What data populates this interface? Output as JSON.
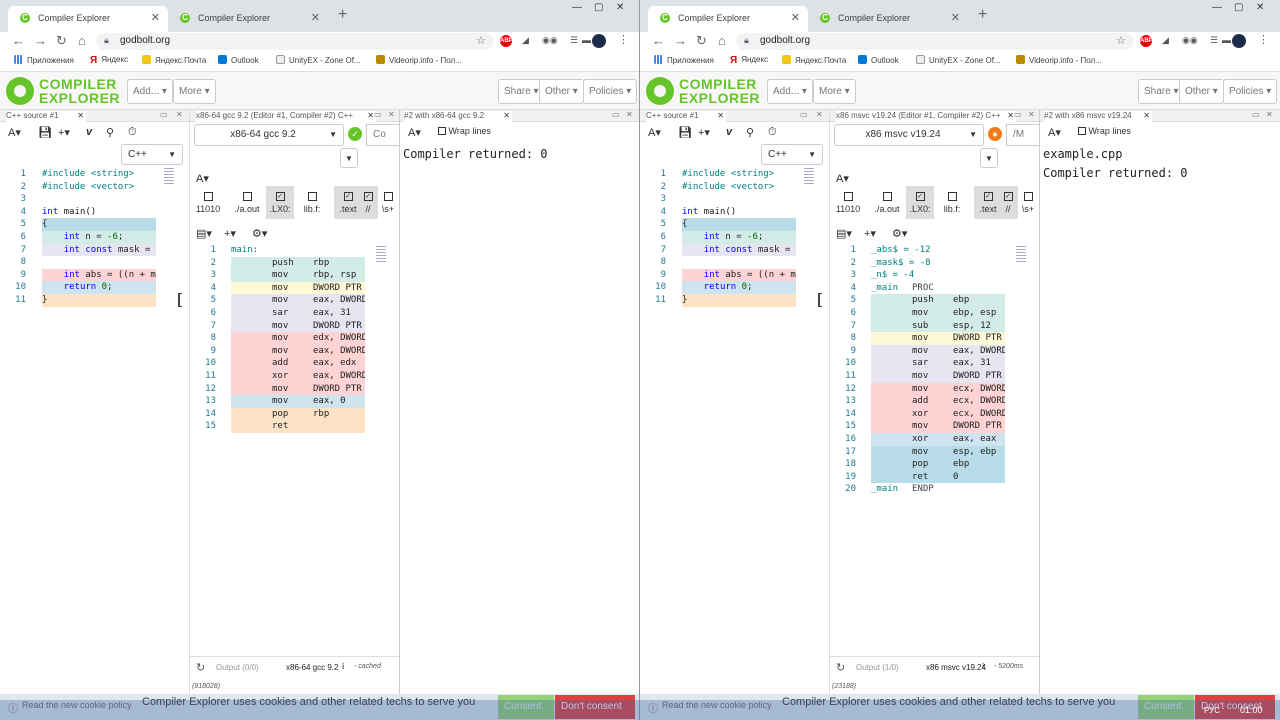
{
  "tabs_left": [
    {
      "label": "Compiler Explorer",
      "favicon": "C"
    },
    {
      "label": "Compiler Explorer",
      "favicon": "C"
    }
  ],
  "tabs_right": [
    {
      "label": "Compiler Explorer",
      "favicon": "C"
    },
    {
      "label": "Compiler Explorer",
      "favicon": "C"
    }
  ],
  "address": {
    "url": "godbolt.org"
  },
  "extensions": {
    "abp": "ABP"
  },
  "bookmarks": [
    "Приложения",
    "Яндекс",
    "Яндекс.Почта",
    "Outlook",
    "UnityEX - Zone Of...",
    "Videorip.info - Пол..."
  ],
  "colors": {
    "accent": "#67c52a",
    "asm_push": "#d4ece8",
    "asm_lavender": "#e6e6f2",
    "asm_yellow": "#fdf8d6",
    "asm_red": "#fdd3d3",
    "asm_blue": "#d0e4f0",
    "asm_orange": "#fde3c6",
    "asm_teal": "#b8dde8",
    "consent": "#67c52a",
    "dont_consent": "#e04040"
  },
  "header": {
    "logo_line1": "COMPILER",
    "logo_line2": "EXPLORER",
    "add": "Add...",
    "more": "More",
    "share": "Share",
    "other": "Other",
    "policies": "Policies"
  },
  "source_code": [
    {
      "n": "1",
      "t": "#include <string>",
      "bg": "none"
    },
    {
      "n": "2",
      "t": "#include <vector>",
      "bg": "none"
    },
    {
      "n": "3",
      "t": "",
      "bg": "none"
    },
    {
      "n": "4",
      "t": "int main()",
      "bg": "none"
    },
    {
      "n": "5",
      "t": "{",
      "bg": "teal"
    },
    {
      "n": "6",
      "t": "    int n = -6;",
      "bg": "push"
    },
    {
      "n": "7",
      "t": "    int const mask = m",
      "bg": "lavender"
    },
    {
      "n": "8",
      "t": "",
      "bg": "none"
    },
    {
      "n": "9",
      "t": "    int abs = ((n + ma",
      "bg": "red"
    },
    {
      "n": "10",
      "t": "    return 0;",
      "bg": "blue"
    },
    {
      "n": "11",
      "t": "}",
      "bg": "orange"
    }
  ],
  "left": {
    "source_tab": "C++ source #1",
    "language": "C++",
    "compiler_tab": "x86-64 gcc 9.2 (Editor #1, Compiler #2) C++",
    "compiler": "x86-64 gcc 9.2",
    "compiler_opts": "Co",
    "output_tab": "#2 with x86-64 gcc 9.2",
    "wrap_lines": "Wrap lines",
    "output_lines": [
      "Compiler returned: 0"
    ],
    "filters": [
      {
        "label": "11010",
        "checked": false
      },
      {
        "label": "./a.out",
        "checked": false
      },
      {
        "label": ".LX0:",
        "checked": true
      },
      {
        "label": "lib.f:",
        "checked": false
      },
      {
        "label": ".text",
        "checked": true
      },
      {
        "label": "//",
        "checked": true
      },
      {
        "label": "\\s+",
        "checked": false
      }
    ],
    "asm": [
      {
        "n": "1",
        "op": "main:",
        "arg": "",
        "bg": "none",
        "label": true
      },
      {
        "n": "2",
        "op": "push",
        "arg": "rbp",
        "bg": "push"
      },
      {
        "n": "3",
        "op": "mov",
        "arg": "rbp, rsp",
        "bg": "push"
      },
      {
        "n": "4",
        "op": "mov",
        "arg": "DWORD PTR",
        "bg": "yellow"
      },
      {
        "n": "5",
        "op": "mov",
        "arg": "eax, DWORD",
        "bg": "lavender"
      },
      {
        "n": "6",
        "op": "sar",
        "arg": "eax, 31",
        "bg": "lavender"
      },
      {
        "n": "7",
        "op": "mov",
        "arg": "DWORD PTR",
        "bg": "lavender"
      },
      {
        "n": "8",
        "op": "mov",
        "arg": "edx, DWORD",
        "bg": "red"
      },
      {
        "n": "9",
        "op": "mov",
        "arg": "eax, DWORD",
        "bg": "red"
      },
      {
        "n": "10",
        "op": "add",
        "arg": "eax, edx",
        "bg": "red"
      },
      {
        "n": "11",
        "op": "xor",
        "arg": "eax, DWORD",
        "bg": "red"
      },
      {
        "n": "12",
        "op": "mov",
        "arg": "DWORD PTR",
        "bg": "red"
      },
      {
        "n": "13",
        "op": "mov",
        "arg": "eax, 0",
        "bg": "blue"
      },
      {
        "n": "14",
        "op": "pop",
        "arg": "rbp",
        "bg": "orange"
      },
      {
        "n": "15",
        "op": "ret",
        "arg": "",
        "bg": "orange"
      }
    ],
    "status": {
      "output": "Output (0/0)",
      "compiler": "x86-64 gcc 9.2",
      "info": "i",
      "cached": "- cached",
      "bytes": "(918028)"
    }
  },
  "right": {
    "source_tab": "C++ source #1",
    "language": "C++",
    "compiler_tab": "x86 msvc v19.24 (Editor #1, Compiler #2) C++",
    "compiler": "x86 msvc v19.24",
    "compiler_opts": "/M",
    "output_tab": "#2 with x86 msvc v19.24",
    "wrap_lines": "Wrap lines",
    "output_lines": [
      "example.cpp",
      "Compiler returned: 0"
    ],
    "filters": [
      {
        "label": "11010",
        "checked": false
      },
      {
        "label": "./a.out",
        "checked": false
      },
      {
        "label": ".LX0:",
        "checked": true
      },
      {
        "label": "lib.f:",
        "checked": false
      },
      {
        "label": ".text",
        "checked": true
      },
      {
        "label": "//",
        "checked": true
      },
      {
        "label": "\\s+",
        "checked": false
      }
    ],
    "asm": [
      {
        "n": "1",
        "op": "_abs$ = -12",
        "arg": "",
        "bg": "none",
        "label": true
      },
      {
        "n": "2",
        "op": "_mask$ = -8",
        "arg": "",
        "bg": "none",
        "label": true
      },
      {
        "n": "3",
        "op": "_n$ = -4",
        "arg": "",
        "bg": "none",
        "label": true
      },
      {
        "n": "4",
        "op": "_main",
        "arg": "PROC",
        "bg": "none",
        "label": true
      },
      {
        "n": "5",
        "op": "push",
        "arg": "ebp",
        "bg": "push"
      },
      {
        "n": "6",
        "op": "mov",
        "arg": "ebp, esp",
        "bg": "push"
      },
      {
        "n": "7",
        "op": "sub",
        "arg": "esp, 12",
        "bg": "push"
      },
      {
        "n": "8",
        "op": "mov",
        "arg": "DWORD PTR",
        "bg": "yellow"
      },
      {
        "n": "9",
        "op": "mov",
        "arg": "eax, DWORD",
        "bg": "lavender"
      },
      {
        "n": "10",
        "op": "sar",
        "arg": "eax, 31",
        "bg": "lavender"
      },
      {
        "n": "11",
        "op": "mov",
        "arg": "DWORD PTR",
        "bg": "lavender"
      },
      {
        "n": "12",
        "op": "mov",
        "arg": "ecx, DWORD",
        "bg": "red"
      },
      {
        "n": "13",
        "op": "add",
        "arg": "ecx, DWORD",
        "bg": "red"
      },
      {
        "n": "14",
        "op": "xor",
        "arg": "ecx, DWORD",
        "bg": "red"
      },
      {
        "n": "15",
        "op": "mov",
        "arg": "DWORD PTR",
        "bg": "red"
      },
      {
        "n": "16",
        "op": "xor",
        "arg": "eax, eax",
        "bg": "blue"
      },
      {
        "n": "17",
        "op": "mov",
        "arg": "esp, ebp",
        "bg": "teal"
      },
      {
        "n": "18",
        "op": "pop",
        "arg": "ebp",
        "bg": "teal"
      },
      {
        "n": "19",
        "op": "ret",
        "arg": "0",
        "bg": "teal"
      },
      {
        "n": "20",
        "op": "_main",
        "arg": "ENDP",
        "bg": "none",
        "label": true
      }
    ],
    "status": {
      "output": "Output (1/0)",
      "compiler": "x86 msvc v19.24",
      "info": "i",
      "cached": "- 5200ms",
      "bytes": "(23188)"
    }
  },
  "cookie": {
    "read_policy": "Read the new cookie policy",
    "message": "Compiler Explorer uses cookies and other related techs to serve you",
    "consent": "Consent",
    "dont_consent": "Don't consent"
  },
  "taskbar": {
    "lang": "РУС",
    "time": "01:00"
  }
}
